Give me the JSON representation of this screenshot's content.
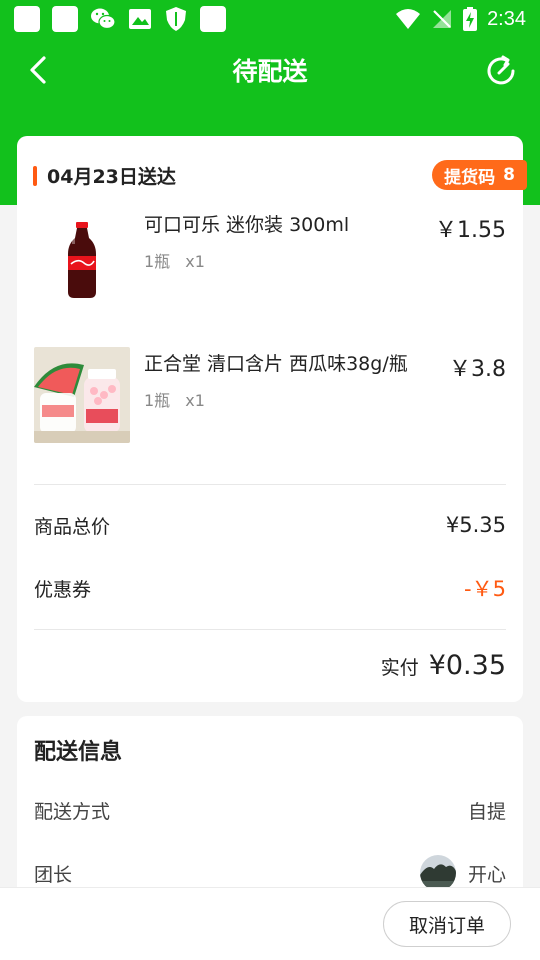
{
  "status_bar": {
    "time": "2:34",
    "icons": [
      "notification-square-icon",
      "notification-square-icon",
      "wechat-icon",
      "image-icon",
      "shield-icon",
      "notification-square-icon",
      "wifi-icon",
      "no-signal-icon",
      "battery-charging-icon"
    ]
  },
  "nav": {
    "title": "待配送",
    "back_icon": "chevron-left-icon",
    "refresh_icon": "refresh-icon"
  },
  "order": {
    "delivery_date": "04月23日送达",
    "pickup_code_label": "提货码",
    "pickup_code": "8",
    "items": [
      {
        "name": "可口可乐 迷你装 300ml",
        "unit": "1瓶",
        "qty": "x1",
        "price": "￥1.55",
        "image": "coca-cola-bottle"
      },
      {
        "name": "正合堂 清口含片 西瓜味38g/瓶",
        "unit": "1瓶",
        "qty": "x1",
        "price": "￥3.8",
        "image": "watermelon-mints-bottle"
      }
    ],
    "subtotal_label": "商品总价",
    "subtotal_value": "¥5.35",
    "coupon_label": "优惠券",
    "coupon_value": "-￥5",
    "paid_label": "实付",
    "paid_value": "¥0.35"
  },
  "delivery": {
    "title": "配送信息",
    "method_label": "配送方式",
    "method_value": "自提",
    "leader_label": "团长",
    "leader_name": "开心"
  },
  "footer": {
    "cancel_label": "取消订单"
  },
  "colors": {
    "brand_green": "#12c11c",
    "accent_orange": "#ff5a12"
  }
}
